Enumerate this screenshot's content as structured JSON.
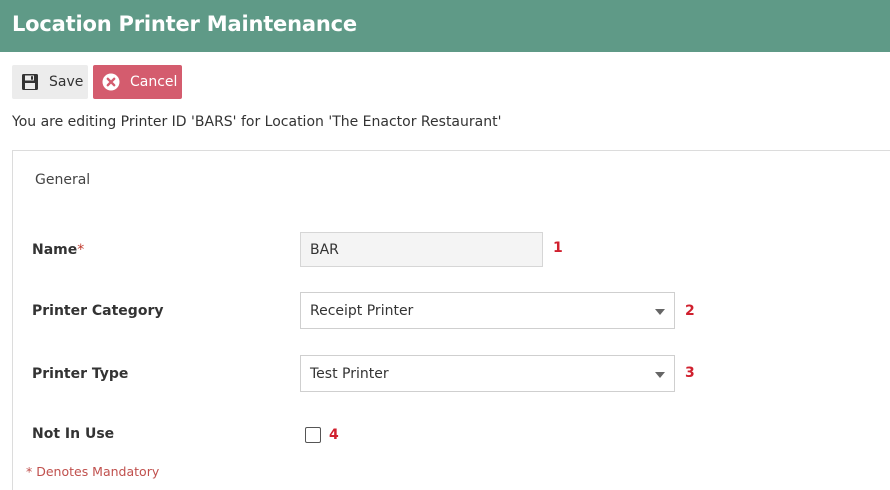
{
  "header": {
    "title": "Location Printer Maintenance"
  },
  "toolbar": {
    "save_label": "Save",
    "cancel_label": "Cancel"
  },
  "editing_note": "You are editing Printer ID 'BARS' for Location 'The Enactor Restaurant'",
  "panel": {
    "title": "General"
  },
  "form": {
    "name": {
      "label": "Name",
      "required_mark": "*",
      "value": "BAR",
      "marker": "1"
    },
    "printer_category": {
      "label": "Printer Category",
      "value": "Receipt Printer",
      "marker": "2"
    },
    "printer_type": {
      "label": "Printer Type",
      "value": "Test Printer",
      "marker": "3"
    },
    "not_in_use": {
      "label": "Not In Use",
      "checked": false,
      "marker": "4"
    }
  },
  "mandatory_note": "* Denotes Mandatory",
  "colors": {
    "header_bg": "#5f9a87",
    "cancel_bg": "#d45c6e",
    "marker": "#d0202e"
  },
  "icons": {
    "save": "floppy-disk-icon",
    "cancel": "close-circle-icon",
    "dropdown": "caret-down-icon"
  }
}
